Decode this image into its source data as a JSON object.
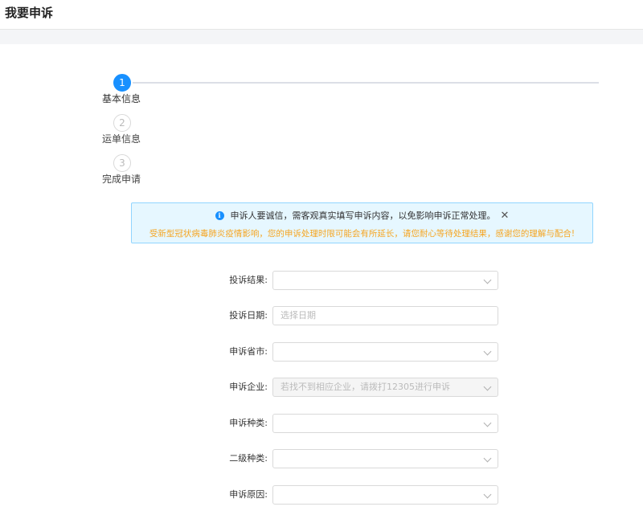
{
  "header": {
    "title": "我要申诉"
  },
  "steps": [
    {
      "number": "1",
      "label": "基本信息",
      "status": "active"
    },
    {
      "number": "2",
      "label": "运单信息",
      "status": "pending"
    },
    {
      "number": "3",
      "label": "完成申请",
      "status": "pending"
    }
  ],
  "notice": {
    "message": "申诉人要诚信，需客观真实填写申诉内容，以免影响申诉正常处理。",
    "warning": "受新型冠状病毒肺炎疫情影响，您的申诉处理时限可能会有所延长，请您耐心等待处理结果，感谢您的理解与配合!",
    "info_icon": "info-circle-icon",
    "close_icon": "close-icon",
    "colors": {
      "info": "#1890ff",
      "warning": "#f5a623",
      "border": "#91d5ff",
      "background": "#e6f7ff"
    }
  },
  "form": {
    "result_label": "投诉结果:",
    "result_value": "",
    "date_label": "投诉日期:",
    "date_placeholder": "选择日期",
    "province_label": "申诉省市:",
    "province_value": "",
    "company_label": "申诉企业:",
    "company_placeholder": "若找不到相应企业，请拨打12305进行申诉",
    "type_label": "申诉种类:",
    "type_value": "",
    "subtype_label": "二级种类:",
    "subtype_value": "",
    "reason_label": "申诉原因:",
    "reason_value": ""
  }
}
